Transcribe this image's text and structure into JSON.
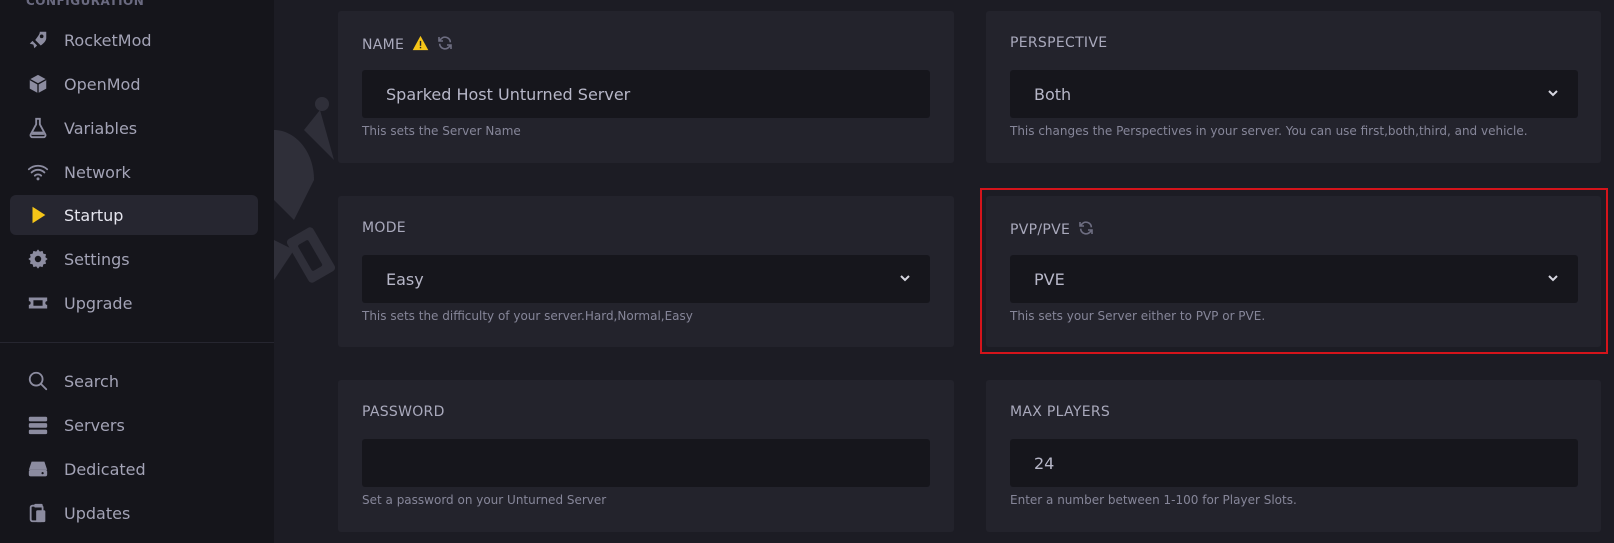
{
  "sidebar": {
    "section_title": "CONFIGURATION",
    "items": [
      {
        "label": "RocketMod",
        "icon": "rocket-icon"
      },
      {
        "label": "OpenMod",
        "icon": "cube-icon"
      },
      {
        "label": "Variables",
        "icon": "flask-icon"
      },
      {
        "label": "Network",
        "icon": "wifi-icon"
      },
      {
        "label": "Startup",
        "icon": "play-icon",
        "active": true
      },
      {
        "label": "Settings",
        "icon": "gear-icon"
      },
      {
        "label": "Upgrade",
        "icon": "ticket-icon"
      }
    ],
    "bottom_items": [
      {
        "label": "Search",
        "icon": "search-icon"
      },
      {
        "label": "Servers",
        "icon": "servers-icon"
      },
      {
        "label": "Dedicated",
        "icon": "hdd-icon"
      },
      {
        "label": "Updates",
        "icon": "clipboard-icon"
      }
    ]
  },
  "cards": {
    "name": {
      "label": "NAME",
      "value": "Sparked Host Unturned Server",
      "help": "This sets the Server Name"
    },
    "perspective": {
      "label": "PERSPECTIVE",
      "value": "Both",
      "help": "This changes the Perspectives in your server. You can use first,both,third, and vehicle."
    },
    "mode": {
      "label": "MODE",
      "value": "Easy",
      "help": "This sets the difficulty of your server.Hard,Normal,Easy"
    },
    "pvp": {
      "label": "PVP/PVE",
      "value": "PVE",
      "help": "This sets your Server either to PVP or PVE."
    },
    "password": {
      "label": "PASSWORD",
      "value": "",
      "help": "Set a password on your Unturned Server"
    },
    "max_players": {
      "label": "MAX PLAYERS",
      "value": "24",
      "help": "Enter a number between 1-100 for Player Slots."
    }
  },
  "colors": {
    "accent_yellow": "#f5c518",
    "highlight_red": "#d4141b",
    "sidebar_bg": "#15151b",
    "card_bg": "#23232c",
    "field_bg": "#16161c"
  }
}
